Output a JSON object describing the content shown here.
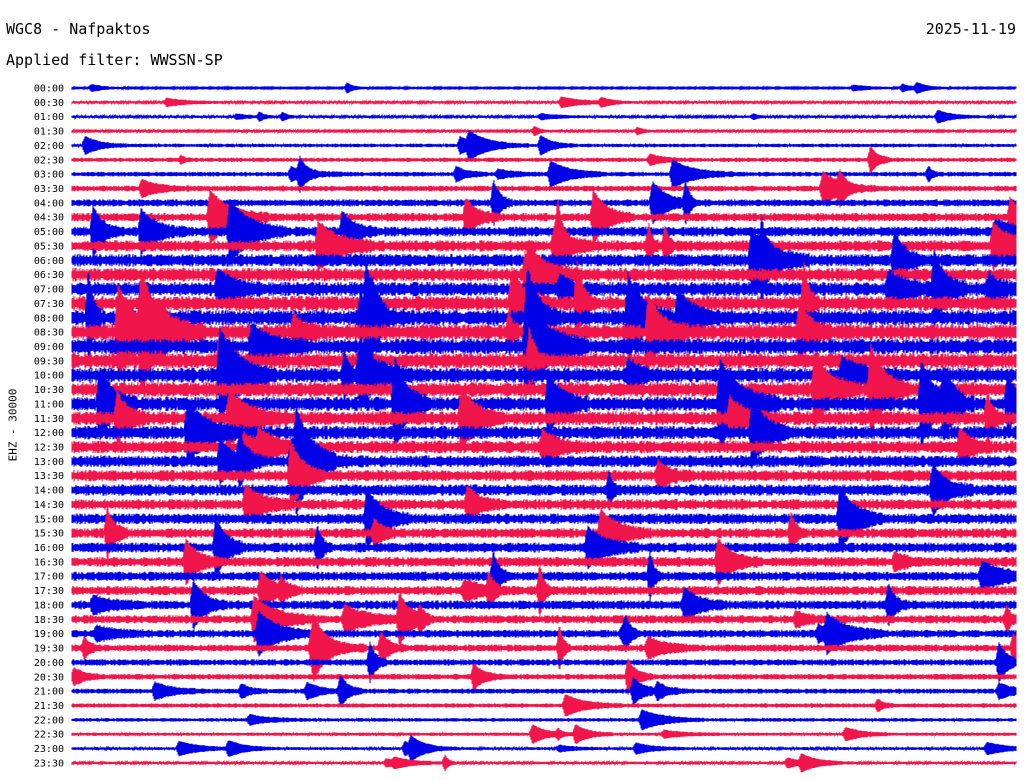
{
  "header": {
    "station": "WGC8 - Nafpaktos",
    "date": "2025-11-19",
    "filter": "Applied filter: WWSSN-SP"
  },
  "channel_label": "EHZ - 30000",
  "colors": {
    "trace_a": "#0000e6",
    "trace_b": "#f0154a",
    "background": "#ffffff",
    "text": "#000000"
  },
  "chart_data": {
    "type": "helicorder",
    "row_interval_minutes": 30,
    "trace_colors": [
      "blue",
      "red"
    ],
    "row_labels": [
      "00:00",
      "00:30",
      "01:00",
      "01:30",
      "02:00",
      "02:30",
      "03:00",
      "03:30",
      "04:00",
      "04:30",
      "05:00",
      "05:30",
      "06:00",
      "06:30",
      "07:00",
      "07:30",
      "08:00",
      "08:30",
      "09:00",
      "09:30",
      "10:00",
      "10:30",
      "11:00",
      "11:30",
      "12:00",
      "12:30",
      "13:00",
      "13:30",
      "14:00",
      "14:30",
      "15:00",
      "15:30",
      "16:00",
      "16:30",
      "17:00",
      "17:30",
      "18:00",
      "18:30",
      "19:00",
      "19:30",
      "20:00",
      "20:30",
      "21:00",
      "21:30",
      "22:00",
      "22:30",
      "23:00",
      "23:30"
    ],
    "relative_amplitude": [
      0.25,
      0.35,
      0.35,
      0.3,
      0.5,
      0.6,
      0.65,
      0.8,
      1.0,
      1.2,
      1.4,
      1.6,
      1.8,
      1.9,
      2.0,
      2.1,
      2.2,
      2.3,
      2.2,
      2.2,
      2.1,
      2.1,
      2.0,
      2.0,
      1.9,
      1.8,
      1.7,
      1.6,
      1.6,
      1.5,
      1.5,
      1.4,
      1.4,
      1.4,
      1.3,
      1.3,
      1.3,
      1.2,
      1.1,
      1.0,
      0.9,
      0.8,
      0.7,
      0.6,
      0.5,
      0.45,
      0.4,
      0.35
    ]
  }
}
